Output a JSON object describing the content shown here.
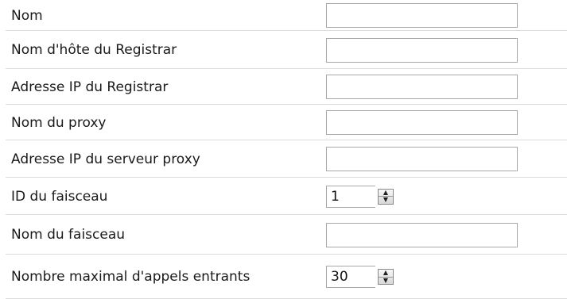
{
  "fields": [
    {
      "label": "Nom",
      "value": ""
    },
    {
      "label": "Nom d'hôte du Registrar",
      "value": ""
    },
    {
      "label": "Adresse IP du Registrar",
      "value": ""
    },
    {
      "label": "Nom du proxy",
      "value": ""
    },
    {
      "label": "Adresse IP du serveur proxy",
      "value": ""
    },
    {
      "label": "ID du faisceau",
      "value": "1"
    },
    {
      "label": "Nom du faisceau",
      "value": ""
    },
    {
      "label": "Nombre maximal d'appels entrants",
      "value": "30"
    }
  ],
  "icons": {
    "spin_up": "arrow-up",
    "spin_down": "arrow-down"
  }
}
